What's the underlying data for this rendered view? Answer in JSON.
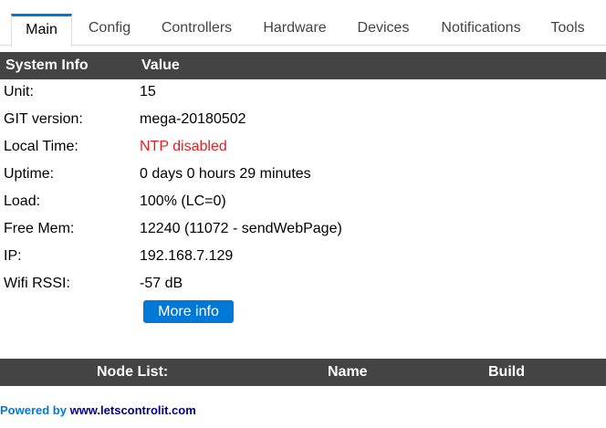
{
  "tabs": [
    "Main",
    "Config",
    "Controllers",
    "Hardware",
    "Devices",
    "Notifications",
    "Tools"
  ],
  "system_info_header": {
    "label": "System Info",
    "value": "Value"
  },
  "system_info": [
    {
      "label": "Unit:",
      "value": "15",
      "color": "#000000"
    },
    {
      "label": "GIT version:",
      "value": "mega-20180502",
      "color": "#000000"
    },
    {
      "label": "Local Time:",
      "value": "NTP disabled",
      "color": "#e02020"
    },
    {
      "label": "Uptime:",
      "value": "0 days 0 hours 29 minutes",
      "color": "#000000"
    },
    {
      "label": "Load:",
      "value": "100% (LC=0)",
      "color": "#000000"
    },
    {
      "label": "Free Mem:",
      "value": "12240 (11072 - sendWebPage)",
      "color": "#000000"
    },
    {
      "label": "IP:",
      "value": "192.168.7.129",
      "color": "#000000"
    },
    {
      "label": "Wifi RSSI:",
      "value": "-57 dB",
      "color": "#000000"
    }
  ],
  "more_info_button": "More info",
  "node_list_header": {
    "node_list": "Node List:",
    "name": "Name",
    "build": "Build"
  },
  "footer": {
    "prefix": "Powered by ",
    "link": "www.letscontrolit.com"
  },
  "colors": {
    "accent": "#0078d7",
    "header_bg": "#444444",
    "warning": "#e02020"
  }
}
